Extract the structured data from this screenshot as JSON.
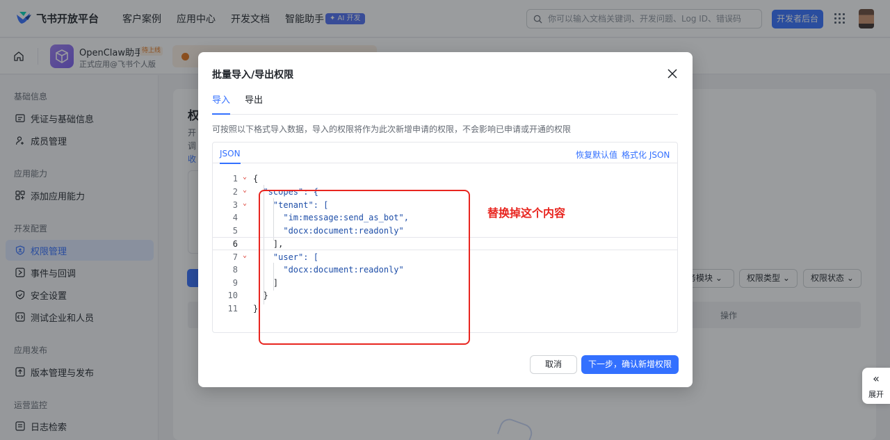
{
  "topnav": {
    "logo_text": "飞书开放平台",
    "items": [
      "客户案例",
      "应用中心",
      "开发文档",
      "智能助手"
    ],
    "ai_badge": "✦ AI 开发",
    "search_placeholder": "你可以输入文档关键词、开发问题、Log ID、错误码",
    "dev_button": "开发者后台"
  },
  "appbar": {
    "app_name": "OpenClaw助手",
    "app_tag": "待上线",
    "app_sub": "正式应用@飞书个人版"
  },
  "sidebar": {
    "groups": [
      {
        "label": "基础信息",
        "items": [
          "凭证与基础信息",
          "成员管理"
        ]
      },
      {
        "label": "应用能力",
        "items": [
          "添加应用能力"
        ]
      },
      {
        "label": "开发配置",
        "items": [
          "权限管理",
          "事件与回调",
          "安全设置",
          "测试企业和人员"
        ]
      },
      {
        "label": "应用发布",
        "items": [
          "版本管理与发布"
        ]
      },
      {
        "label": "运营监控",
        "items": [
          "日志检索"
        ]
      }
    ],
    "active_item": "权限管理"
  },
  "background": {
    "title_fragment": "权",
    "text1_fragment": "开",
    "text2_fragment": "调",
    "link_fragment": "收",
    "filters": [
      "务模块 ⌄",
      "权限类型 ⌄",
      "权限状态 ⌄"
    ],
    "table_op": "操作"
  },
  "expand_tab": {
    "icon": "«",
    "label": "展开"
  },
  "modal": {
    "title": "批量导入/导出权限",
    "tabs": [
      "导入",
      "导出"
    ],
    "active_tab": "导入",
    "description": "可按照以下格式导入数据，导入的权限将作为此次新增申请的权限，不会影响已申请或开通的权限",
    "editor_tab": "JSON",
    "restore_link": "恢复默认值",
    "format_link": "格式化 JSON",
    "code_lines": [
      "{",
      "  \"scopes\": {",
      "    \"tenant\": [",
      "      \"im:message:send_as_bot\",",
      "      \"docx:document:readonly\"",
      "    ],",
      "    \"user\": [",
      "      \"docx:document:readonly\"",
      "    ]",
      "  }",
      "}"
    ],
    "annotation": "替换掉这个内容",
    "cancel_button": "取消",
    "next_button": "下一步，确认新增权限"
  },
  "colors": {
    "accent": "#3370ff",
    "annotation_red": "#e8251f",
    "app_tag": "#e37318"
  }
}
